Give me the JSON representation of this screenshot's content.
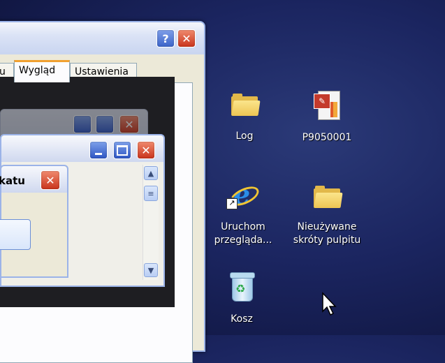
{
  "dialog": {
    "tabs": [
      {
        "label": "u"
      },
      {
        "label": "Wygląd",
        "active": true
      },
      {
        "label": "Ustawienia"
      }
    ],
    "help_label": "?",
    "close_label": "✕"
  },
  "message_box": {
    "title_fragment": "katu",
    "close_label": "✕"
  },
  "desktop": {
    "icons": [
      {
        "label": "Log",
        "icon": "folder-icon"
      },
      {
        "label": "P9050001",
        "icon": "powerpoint-file-icon"
      },
      {
        "label_line1": "Uruchom",
        "label_line2": "przeglądа...",
        "icon": "internet-explorer-icon"
      },
      {
        "label_line1": "Nieużywane",
        "label_line2": "skróty pulpitu",
        "icon": "folder-icon"
      },
      {
        "label": "Kosz",
        "icon": "recycle-bin-icon"
      }
    ]
  },
  "colors": {
    "desktop_bg": "#1b2560",
    "title_close": "#c9341c",
    "tab_highlight": "#f0a030"
  }
}
